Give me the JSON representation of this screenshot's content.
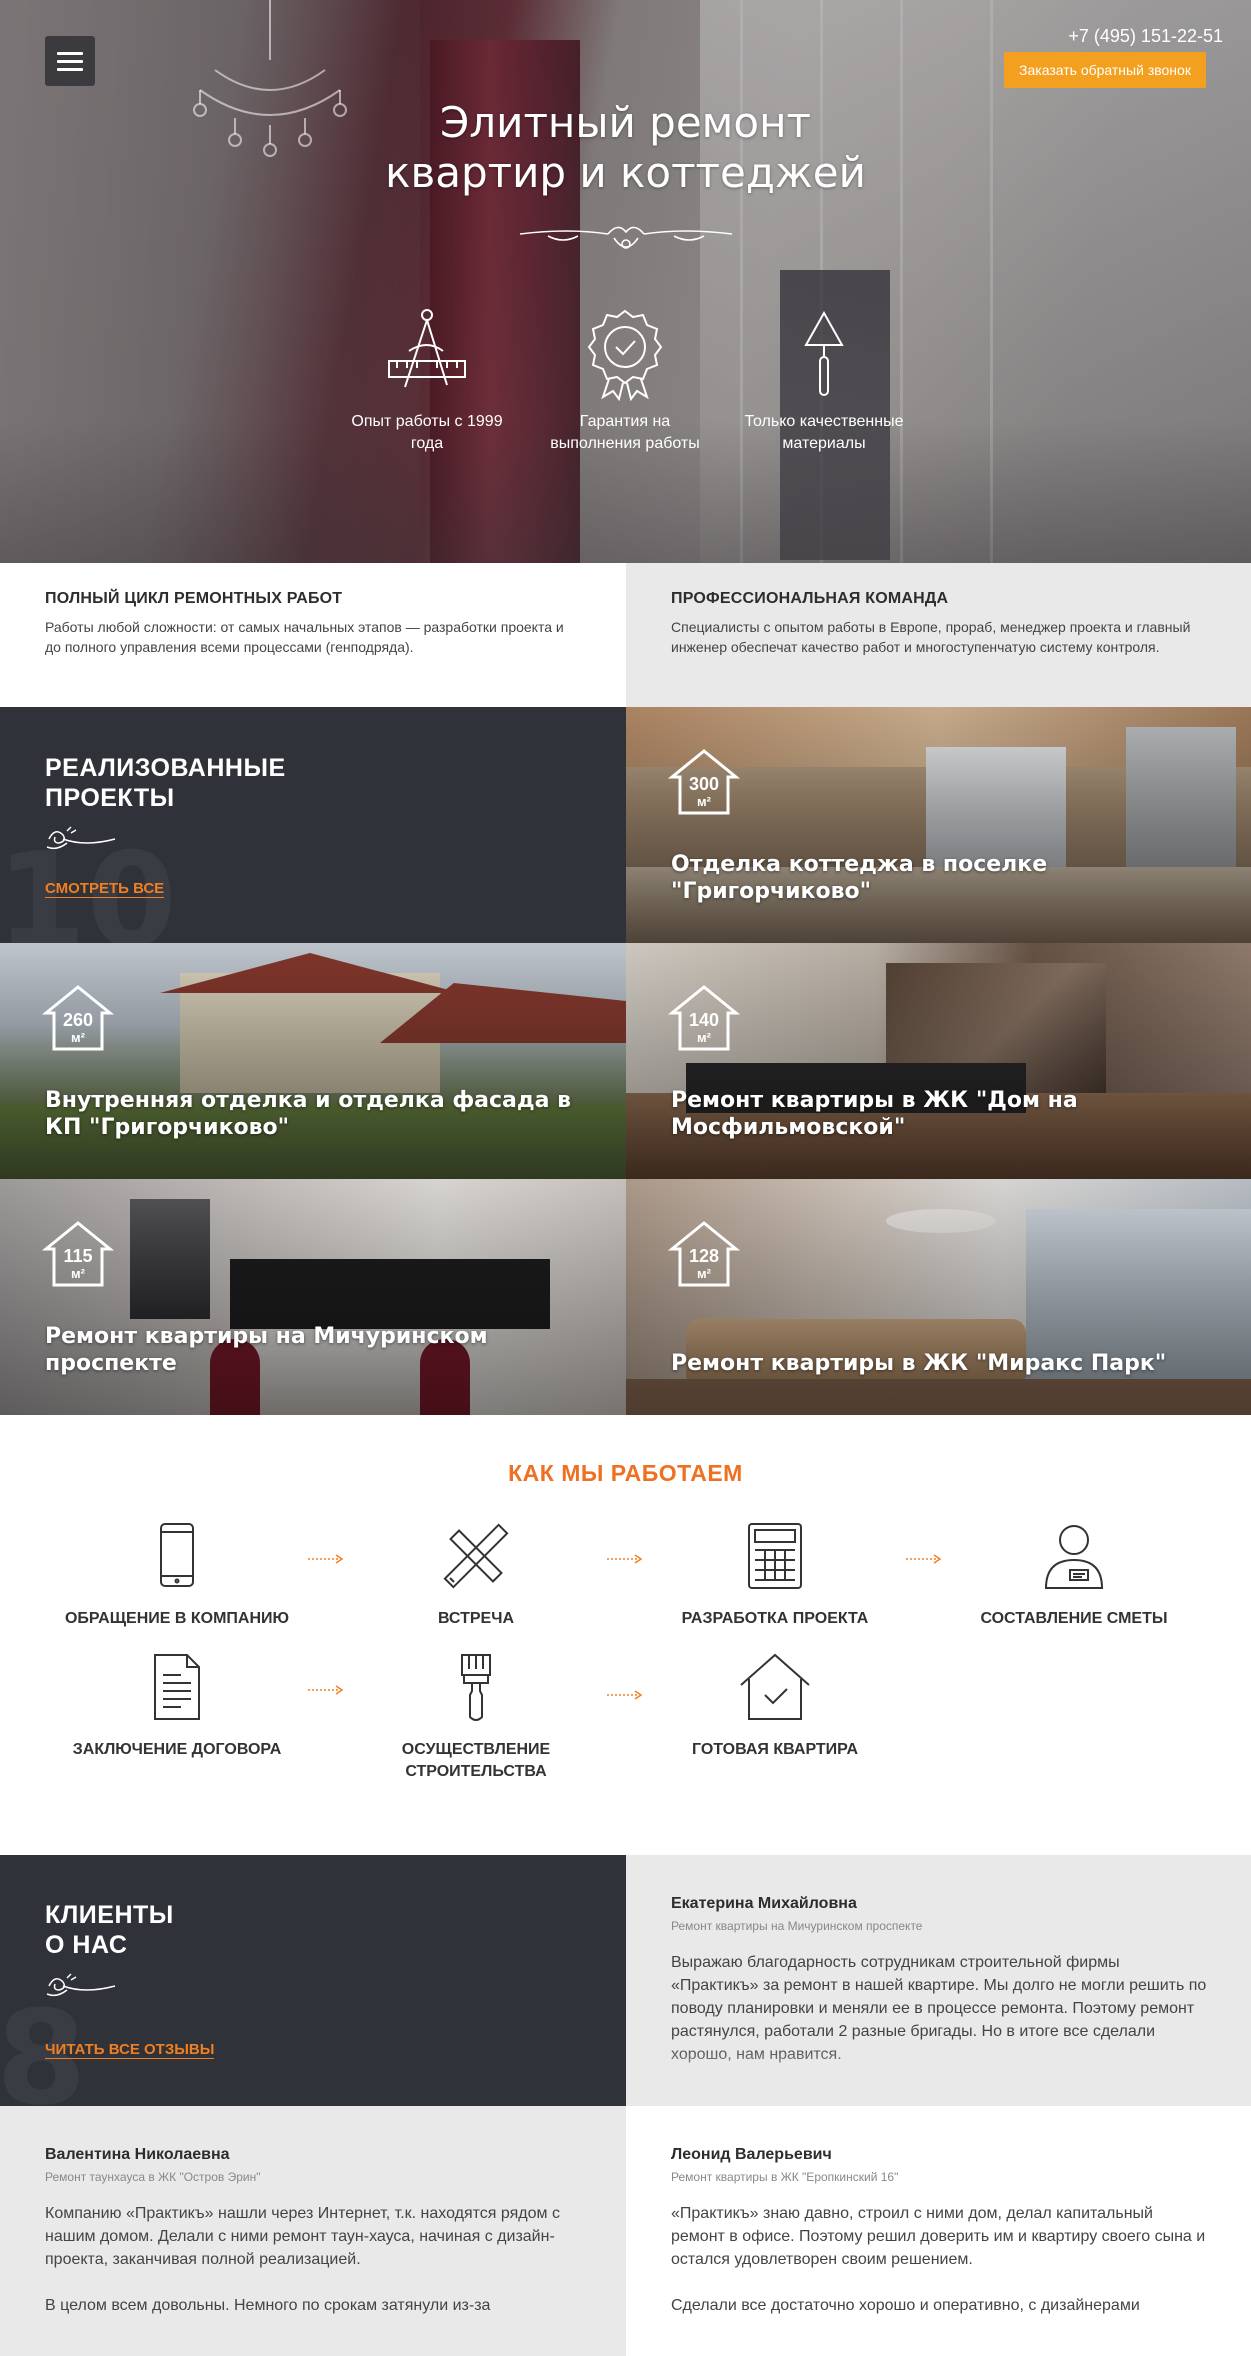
{
  "header": {
    "phone": "+7 (495) 151-22-51",
    "callback_label": "Заказать обратный звонок",
    "title_line1": "Элитный ремонт",
    "title_line2": "квартир и коттеджей"
  },
  "features": [
    {
      "icon": "drafting-tools-icon",
      "text_line1": "Опыт работы с 1999",
      "text_line2": "года"
    },
    {
      "icon": "quality-badge-icon",
      "text_line1": "Гарантия на",
      "text_line2": "выполнения работы"
    },
    {
      "icon": "trowel-icon",
      "text_line1": "Только качественные",
      "text_line2": "материалы"
    }
  ],
  "info": {
    "left": {
      "title": "ПОЛНЫЙ ЦИКЛ РЕМОНТНЫХ РАБОТ",
      "text": "Работы любой сложности: от самых начальных этапов — разработки проекта и до полного управления всеми процессами (генподряда)."
    },
    "right": {
      "title": "ПРОФЕССИОНАЛЬНАЯ КОМАНДА",
      "text": "Специалисты с опытом работы в Европе, прораб, менеджер проекта и главный инженер обеспечат качество работ и многоступенчатую систему контроля."
    }
  },
  "projects": {
    "title_line1": "РЕАЛИЗОВАННЫЕ",
    "title_line2": "ПРОЕКТЫ",
    "count": "10",
    "see_all": "СМОТРЕТЬ ВСЕ",
    "unit": "м²",
    "items": [
      {
        "area": "300",
        "title": "Отделка коттеджа в поселке \"Григорчиково\""
      },
      {
        "area": "260",
        "title": "Внутренняя отделка и отделка фасада в КП \"Григорчиково\""
      },
      {
        "area": "140",
        "title": "Ремонт квартиры в ЖК \"Дом на Мосфильмовской\""
      },
      {
        "area": "115",
        "title": "Ремонт квартиры на Мичуринском проспекте"
      },
      {
        "area": "128",
        "title": "Ремонт квартиры в ЖК \"Миракс Парк\""
      }
    ]
  },
  "process": {
    "title": "КАК МЫ РАБОТАЕМ",
    "steps": [
      {
        "icon": "smartphone-icon",
        "label": "ОБРАЩЕНИЕ В КОМПАНИЮ"
      },
      {
        "icon": "ruler-pencil-icon",
        "label": "ВСТРЕЧА"
      },
      {
        "icon": "calculator-icon",
        "label": "РАЗРАБОТКА ПРОЕКТА"
      },
      {
        "icon": "manager-icon",
        "label": "СОСТАВЛЕНИЕ СМЕТЫ"
      },
      {
        "icon": "document-icon",
        "label": "ЗАКЛЮЧЕНИЕ ДОГОВОРА"
      },
      {
        "icon": "paint-brush-icon",
        "label_line1": "ОСУЩЕСТВЛЕНИЕ",
        "label_line2": "СТРОИТЕЛЬСТВА"
      },
      {
        "icon": "house-check-icon",
        "label": "ГОТОВАЯ КВАРТИРА"
      }
    ]
  },
  "clients": {
    "title_line1": "КЛИЕНТЫ",
    "title_line2": "О НАС",
    "count": "8",
    "read_all": "ЧИТАТЬ ВСЕ ОТЗЫВЫ",
    "reviews": [
      {
        "name": "Екатерина Михайловна",
        "subtitle": "Ремонт квартиры на Мичуринском проспекте",
        "text": "Выражаю благодарность сотрудникам строительной фирмы «Практикъ» за ремонт в нашей квартире. Мы долго не могли решить по поводу планировки и меняли ее в процессе ремонта. Поэтому ремонт растянулся, работали 2 разные бригады. Но в итоге все сделали хорошо, нам нравится."
      },
      {
        "name": "Валентина Николаевна",
        "subtitle": "Ремонт таунхауса в ЖК \"Остров Эрин\"",
        "text": "Компанию «Практикъ» нашли через Интернет, т.к. находятся рядом с нашим домом. Делали с ними ремонт таун-хауса, начиная с дизайн-проекта, заканчивая полной реализацией.",
        "text2": "В целом всем довольны. Немного по срокам затянули из-за"
      },
      {
        "name": "Леонид Валерьевич",
        "subtitle": "Ремонт квартиры в ЖК \"Еропкинский 16\"",
        "text": "«Практикъ» знаю давно, строил с ними дом, делал капитальный ремонт в офисе. Поэтому решил доверить им и квартиру своего сына и остался удовлетворен своим решением.",
        "text2": "Сделали все достаточно хорошо и оперативно, с дизайнерами"
      }
    ]
  },
  "colors": {
    "accent_orange": "#f07f22",
    "button_yellow": "#f3a020",
    "dark_panel": "#2f3238",
    "light_panel": "#e9e9e9"
  }
}
